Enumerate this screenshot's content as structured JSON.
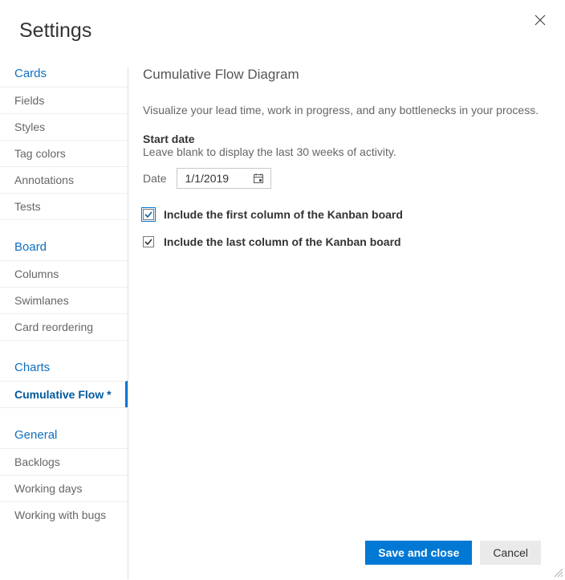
{
  "dialog": {
    "title": "Settings",
    "close_label": "Close"
  },
  "sidebar": {
    "sections": {
      "cards": {
        "label": "Cards",
        "items": [
          "Fields",
          "Styles",
          "Tag colors",
          "Annotations",
          "Tests"
        ]
      },
      "board": {
        "label": "Board",
        "items": [
          "Columns",
          "Swimlanes",
          "Card reordering"
        ]
      },
      "charts": {
        "label": "Charts",
        "items": [
          "Cumulative Flow *"
        ]
      },
      "general": {
        "label": "General",
        "items": [
          "Backlogs",
          "Working days",
          "Working with bugs"
        ]
      }
    },
    "active": "Cumulative Flow *"
  },
  "panel": {
    "title": "Cumulative Flow Diagram",
    "description": "Visualize your lead time, work in progress, and any bottlenecks in your process.",
    "start_date_label": "Start date",
    "start_date_hint": "Leave blank to display the last 30 weeks of activity.",
    "date_label": "Date",
    "date_value": "1/1/2019",
    "include_first_label": "Include the first column of the Kanban board",
    "include_first_checked": true,
    "include_last_label": "Include the last column of the Kanban board",
    "include_last_checked": true
  },
  "footer": {
    "save_label": "Save and close",
    "cancel_label": "Cancel"
  }
}
